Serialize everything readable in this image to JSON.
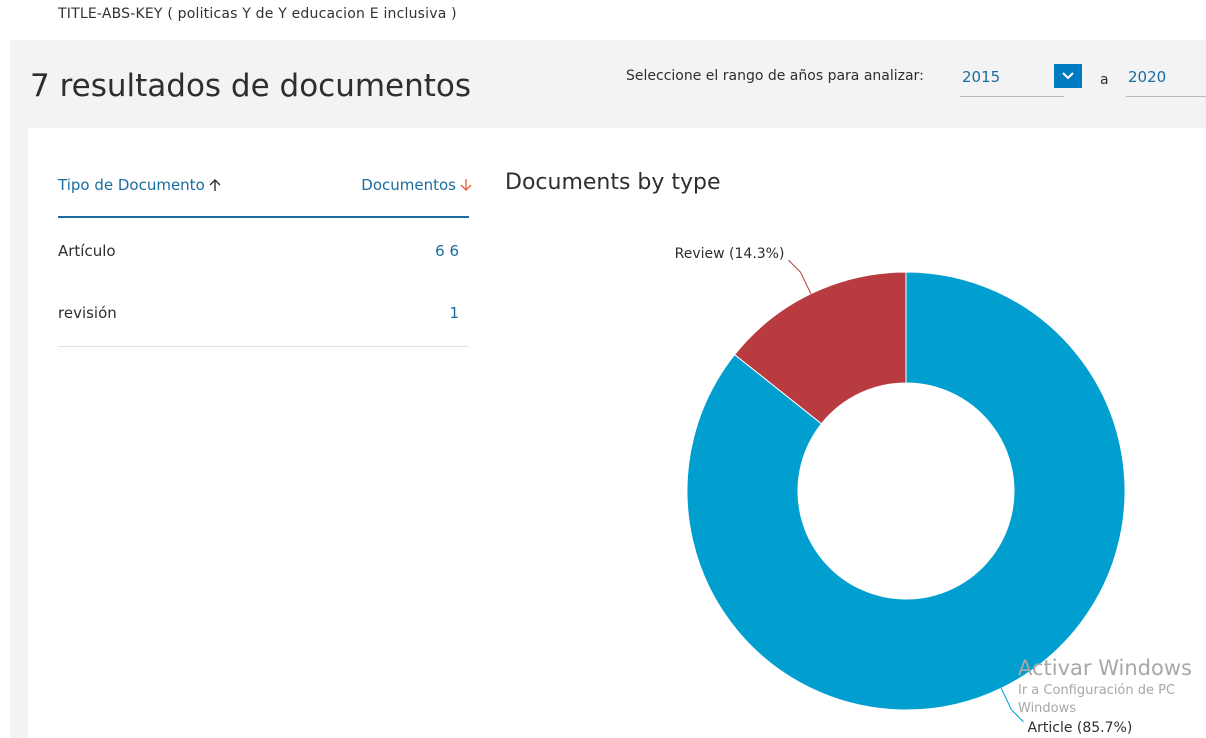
{
  "query": "TITLE-ABS-KEY ( politicas  Y de  Y educacion  E inclusiva )",
  "results_title": "7 resultados de documentos",
  "year_range": {
    "label": "Seleccione el rango de años para analizar:",
    "from": "2015",
    "separator": "a",
    "to": "2020"
  },
  "table": {
    "col_type": "Tipo de Documento",
    "col_count": "Documentos",
    "rows": [
      {
        "type": "Artículo",
        "count": "6 6"
      },
      {
        "type": "revisión",
        "count": "1"
      }
    ]
  },
  "chart_title": "Documents by type",
  "chart_data": {
    "type": "pie",
    "title": "Documents by type",
    "categories": [
      "Article",
      "Review"
    ],
    "values": [
      85.7,
      14.3
    ],
    "labels": [
      "Article (85.7%)",
      "Review (14.3%)"
    ],
    "colors": [
      "#009fcf",
      "#b83b40"
    ]
  },
  "watermark": {
    "title": "Activar Windows",
    "line1": "Ir a Configuración de PC",
    "line2": "Windows"
  },
  "colors": {
    "accent": "#1a6ca0",
    "dropdown": "#007ac0",
    "sort_desc": "#e0663f"
  }
}
